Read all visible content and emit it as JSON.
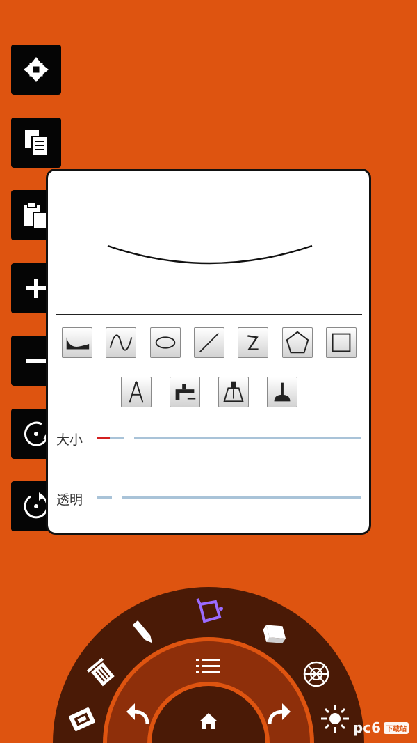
{
  "sidebar": {
    "icons": [
      "move-icon",
      "copy-icon",
      "paste-icon",
      "zoom-in-icon",
      "zoom-out-icon",
      "rotate-ccw-icon",
      "rotate-cw-icon"
    ]
  },
  "brush_panel": {
    "shape_tools": [
      "curve-bowl-icon",
      "sine-wave-icon",
      "ellipse-icon",
      "line-icon",
      "zigzag-icon",
      "pentagon-icon",
      "square-icon"
    ],
    "pen_tools": [
      "compass-icon",
      "t-square-icon",
      "pen-nib-icon",
      "plunger-icon"
    ],
    "size_label": "大小",
    "opacity_label": "透明",
    "size_value_fraction": 0.05
  },
  "wheel": {
    "outer_items": [
      "notebook-icon",
      "trash-icon",
      "pencil-icon",
      "paint-bucket-icon",
      "eraser-icon",
      "color-wheel-icon",
      "light-icon"
    ],
    "inner_items": [
      "undo-icon",
      "menu-icon",
      "redo-icon"
    ],
    "center_item": "home-icon",
    "active_color": "#9B6BFF"
  },
  "watermark": {
    "text": "pc6",
    "tag": "下载站"
  }
}
